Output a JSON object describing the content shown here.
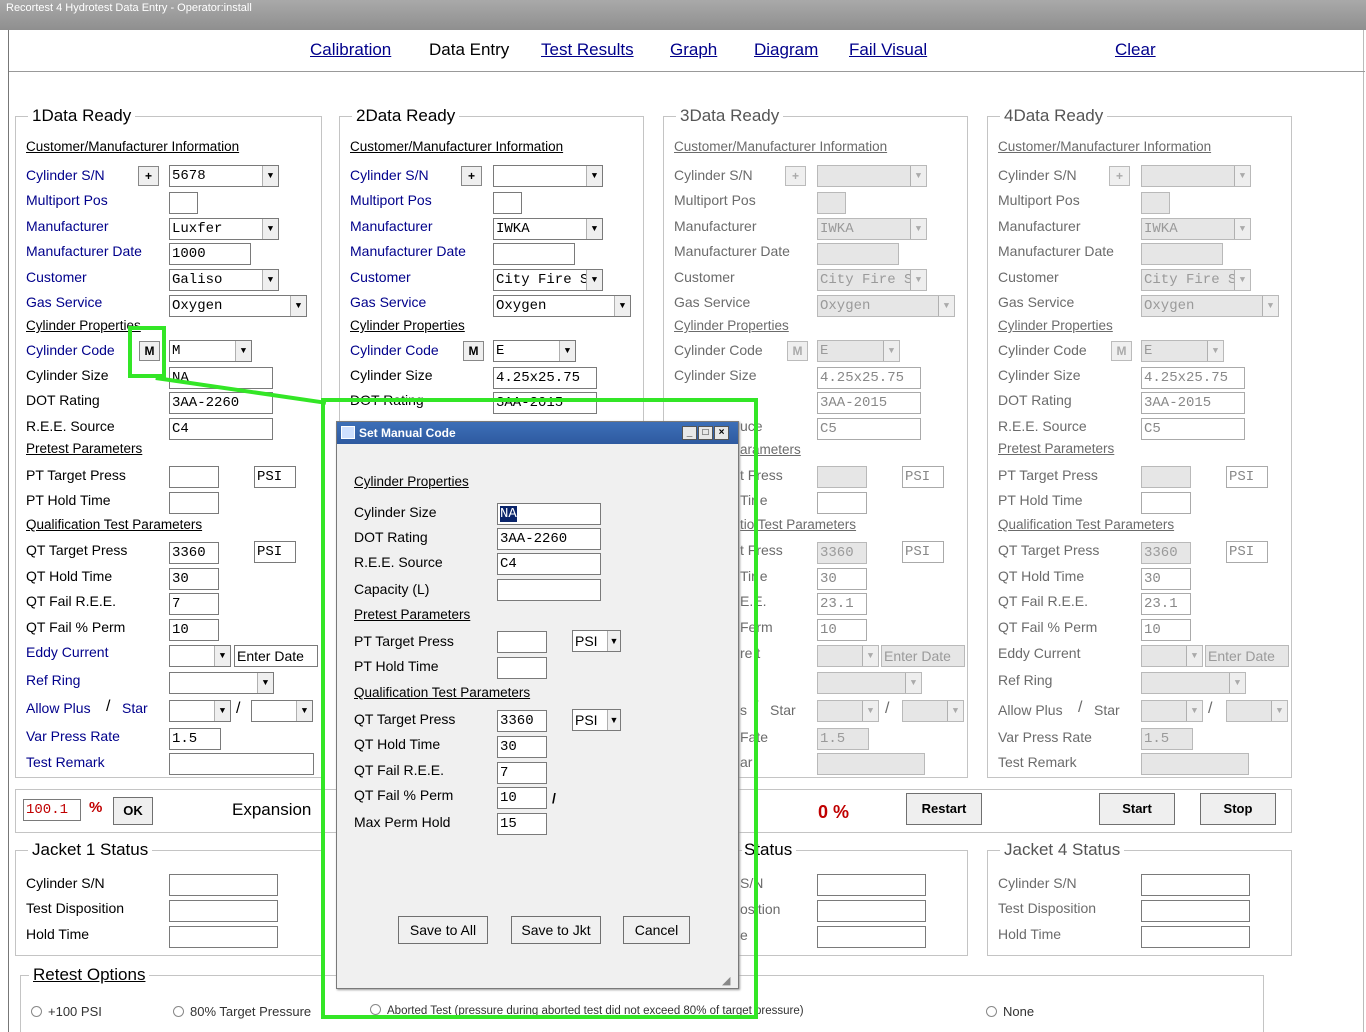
{
  "window": {
    "title": "Recortest 4 Hydrotest Data Entry - Operator:install"
  },
  "nav": {
    "calibration": "Calibration",
    "data_entry": "Data Entry",
    "test_results": "Test Results",
    "graph": "Graph",
    "diagram": "Diagram",
    "fail_visual": "Fail Visual",
    "clear": "Clear"
  },
  "labels": {
    "cust_info": "Customer/Manufacturer Information",
    "cyl_sn": "Cylinder S/N",
    "multiport": "Multiport Pos",
    "manufacturer": "Manufacturer",
    "mfr_date": "Manufacturer Date",
    "customer": "Customer",
    "gas_service": "Gas Service",
    "cyl_props": "Cylinder Properties",
    "cyl_code": "Cylinder Code",
    "cyl_size": "Cylinder Size",
    "dot_rating": "DOT Rating",
    "ree_source": "R.E.E. Source",
    "pretest": "Pretest Parameters",
    "pt_target": "PT Target Press",
    "pt_hold": "PT Hold Time",
    "qual": "Qualification Test Parameters",
    "qt_target": "QT Target Press",
    "qt_hold": "QT Hold Time",
    "qt_fail_ree": "QT Fail R.E.E.",
    "qt_fail_perm": "QT Fail % Perm",
    "eddy": "Eddy Current",
    "ref_ring": "Ref Ring",
    "allow_plus": "Allow Plus",
    "slash": "/",
    "star": "Star",
    "var_press": "Var Press Rate",
    "test_remark": "Test Remark",
    "psi": "PSI",
    "enter_date": "Enter Date",
    "plus": "+",
    "m": "M",
    "test_disp": "Test Disposition",
    "hold_time": "Hold Time",
    "expansion": "Expansion",
    "pct": "%",
    "ok": "OK"
  },
  "stations": [
    {
      "title": "1Data Ready",
      "sn": "5678",
      "multiport": "",
      "manufacturer": "Luxfer",
      "mfr_date": "1000",
      "customer": "Galiso",
      "gas": "Oxygen",
      "code": "M",
      "size": "NA",
      "dot": "3AA-2260",
      "ree": "C4",
      "pt_target": "",
      "pt_hold": "",
      "qt_target": "3360",
      "qt_hold": "30",
      "qt_ree": "7",
      "qt_perm": "10",
      "var_press": "1.5"
    },
    {
      "title": "2Data Ready",
      "sn": "",
      "multiport": "",
      "manufacturer": "IWKA",
      "mfr_date": "",
      "customer": "City Fire St",
      "gas": "Oxygen",
      "code": "E",
      "size": "4.25x25.75",
      "dot": "3AA-2015"
    },
    {
      "title": "3Data Ready",
      "sn": "",
      "manufacturer": "IWKA",
      "customer": "City Fire St",
      "gas": "Oxygen",
      "code": "E",
      "size": "4.25x25.75",
      "dot": "3AA-2015",
      "ree": "C5",
      "qt_target": "3360",
      "qt_hold": "30",
      "qt_ree": "23.1",
      "qt_perm": "10",
      "var_press": "1.5"
    },
    {
      "title": "4Data Ready",
      "sn": "",
      "manufacturer": "IWKA",
      "customer": "City Fire St",
      "gas": "Oxygen",
      "code": "E",
      "size": "4.25x25.75",
      "dot": "3AA-2015",
      "ree": "C5",
      "qt_target": "3360",
      "qt_hold": "30",
      "qt_ree": "23.1",
      "qt_perm": "10",
      "var_press": "1.5"
    }
  ],
  "status_bar": {
    "expansion_pct": "100.1",
    "zero_pct": "0 %",
    "restart": "Restart",
    "start": "Start",
    "stop": "Stop"
  },
  "jackets": {
    "j1": "Jacket 1 Status",
    "j3_frag": "Status",
    "j4": "Jacket 4 Status"
  },
  "retest": {
    "title": "Retest Options",
    "opt1": "+100 PSI",
    "opt2": "80% Target Pressure",
    "opt3": "Aborted Test (pressure during aborted test did not exceed 80% of target pressure)",
    "opt4": "None"
  },
  "dialog": {
    "title": "Set Manual Code",
    "cyl_props": "Cylinder Properties",
    "cyl_size": "Cylinder Size",
    "dot_rating": "DOT Rating",
    "ree_source": "R.E.E. Source",
    "capacity": "Capacity (L)",
    "pretest": "Pretest Parameters",
    "pt_target": "PT Target Press",
    "pt_hold": "PT Hold Time",
    "qual": "Qualification Test Parameters",
    "qt_target": "QT Target Press",
    "qt_hold": "QT Hold Time",
    "qt_fail_ree": "QT Fail R.E.E.",
    "qt_fail_perm": "QT Fail % Perm",
    "max_perm": "Max Perm Hold",
    "v_size": "NA",
    "v_dot": "3AA-2260",
    "v_ree": "C4",
    "v_capacity": "",
    "v_pt_target": "",
    "v_pt_unit": "PSI",
    "v_pt_hold": "",
    "v_qt_target": "3360",
    "v_qt_unit": "PSI",
    "v_qt_hold": "30",
    "v_qt_ree": "7",
    "v_qt_perm": "10",
    "v_max_perm": "15",
    "slash": "/",
    "save_all": "Save to All",
    "save_jkt": "Save to Jkt",
    "cancel": "Cancel"
  },
  "frag": {
    "uce": "uce",
    "arameters": "arameters",
    "t_ress": "t Fress",
    "ime": "Tir e",
    "tion_test": "tio Test Parameters",
    "t_ress2": "t Fress",
    "ime2": "Tir e",
    "ee": "E.E.",
    "perm": "Ferm",
    "rent": "re t",
    "s": "s",
    "star": "Star",
    "rate": "Fate",
    "ark": "ar",
    "sn": "S/N",
    "osition": "osition",
    "e": "e"
  },
  "colors": {
    "accent": "#00008b",
    "highlight": "#33e626",
    "titlebar": "#2e5aa0"
  }
}
